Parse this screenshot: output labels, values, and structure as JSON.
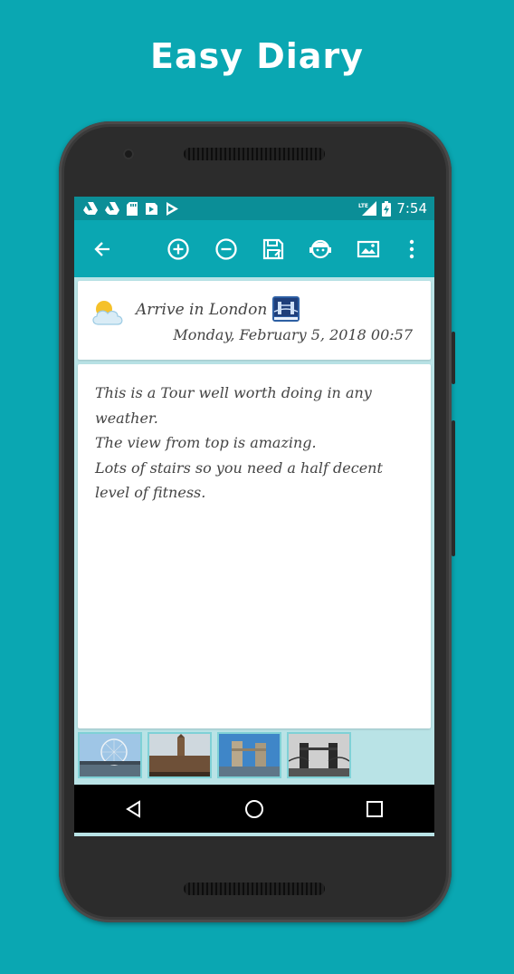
{
  "promo": {
    "title": "Easy Diary"
  },
  "statusbar": {
    "time": "7:54",
    "network": "LTE",
    "notification_icons": [
      "drive-icon",
      "drive-icon",
      "sd-card-icon",
      "play-store-icon",
      "play-icon"
    ]
  },
  "toolbar": {
    "actions": [
      "back-arrow-icon",
      "add-circle-icon",
      "remove-circle-icon",
      "save-icon",
      "face-icon",
      "photo-icon",
      "more-vert-icon"
    ]
  },
  "diary": {
    "weather_icon": "cloud-sun-icon",
    "title": "Arrive in London",
    "title_icon": "bridge-icon",
    "date": "Monday, February 5, 2018 00:57",
    "body_lines": [
      "This is a Tour well worth doing in any",
      "weather.",
      "The view from top is amazing.",
      "Lots of stairs so you need a half decent",
      "level of fitness."
    ],
    "photos": [
      "london-eye-photo",
      "westminster-photo",
      "tower-bridge-photo",
      "tower-bridge-bw-photo"
    ]
  },
  "colors": {
    "background": "#0aa7b2",
    "statusbar": "#0b8e97",
    "toolbar": "#0aa7b2",
    "content_bg": "#b9e3e6",
    "text": "#444444"
  },
  "navbar": {
    "buttons": [
      "back-triangle-icon",
      "home-circle-icon",
      "recents-square-icon"
    ]
  }
}
